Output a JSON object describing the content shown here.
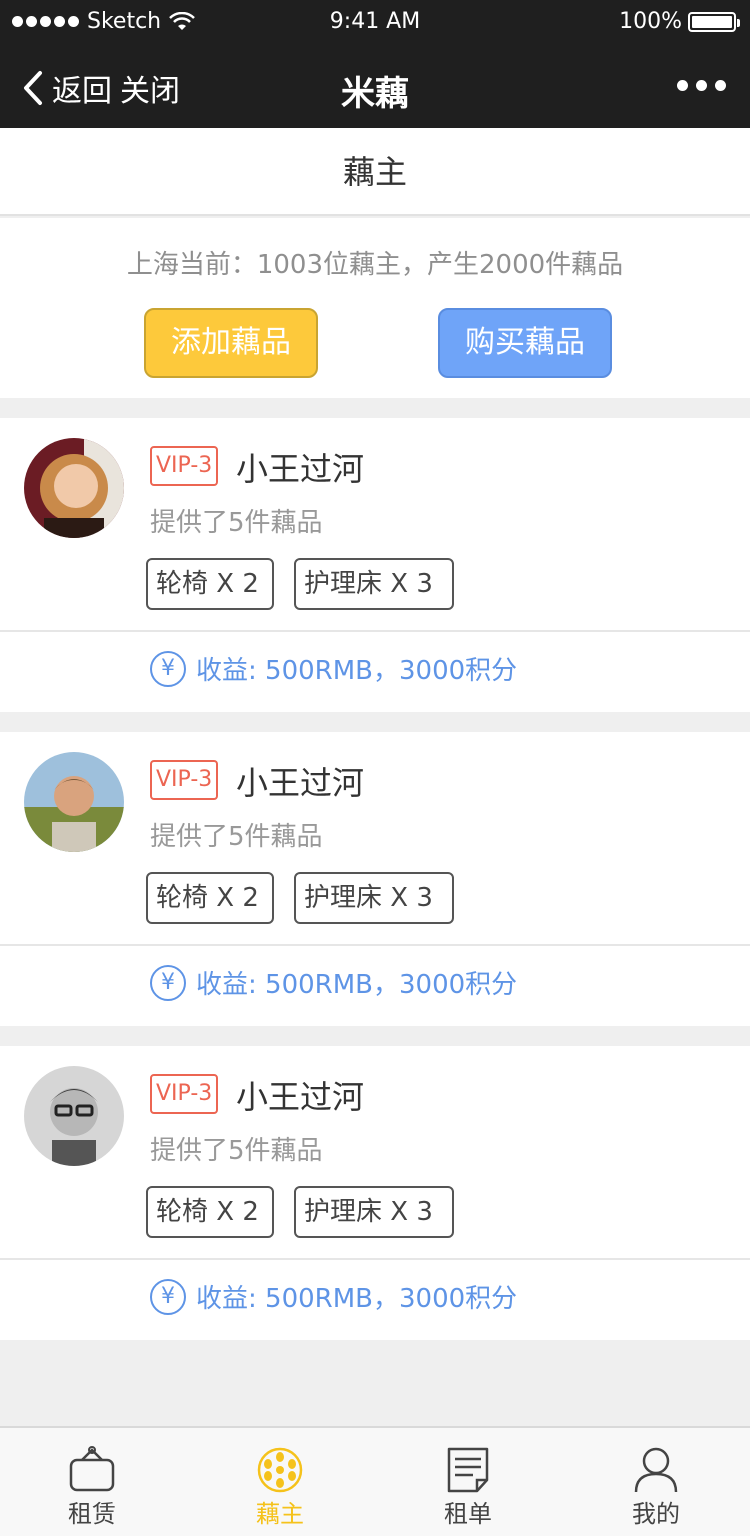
{
  "status_bar": {
    "carrier": "Sketch",
    "time": "9:41 AM",
    "battery": "100%"
  },
  "nav": {
    "back_label": "返回",
    "close_label": "关闭",
    "title": "米藕"
  },
  "tab_header": {
    "title": "藕主"
  },
  "summary": {
    "stat_text": "上海当前：1003位藕主，产生2000件藕品",
    "add_button": "添加藕品",
    "buy_button": "购买藕品"
  },
  "providers": [
    {
      "vip": "VIP-3",
      "name": "小王过河",
      "provided": "提供了5件藕品",
      "tags": [
        "轮椅 X 2",
        "护理床 X 3"
      ],
      "earnings": "收益: 500RMB，3000积分",
      "avatar": "woman-avatar"
    },
    {
      "vip": "VIP-3",
      "name": "小王过河",
      "provided": "提供了5件藕品",
      "tags": [
        "轮椅 X 2",
        "护理床 X 3"
      ],
      "earnings": "收益: 500RMB，3000积分",
      "avatar": "man-avatar"
    },
    {
      "vip": "VIP-3",
      "name": "小王过河",
      "provided": "提供了5件藕品",
      "tags": [
        "轮椅 X 2",
        "护理床 X 3"
      ],
      "earnings": "收益: 500RMB，3000积分",
      "avatar": "glasses-man-avatar"
    }
  ],
  "tabbar": {
    "items": [
      {
        "label": "租赁",
        "icon": "rental-bag-icon"
      },
      {
        "label": "藕主",
        "icon": "lotus-root-icon",
        "active": true
      },
      {
        "label": "租单",
        "icon": "order-list-icon"
      },
      {
        "label": "我的",
        "icon": "user-icon"
      }
    ]
  },
  "colors": {
    "accent_yellow": "#fdc93b",
    "accent_blue": "#6fa4f8",
    "vip_red": "#ec6552",
    "earn_blue": "#5e94e6"
  }
}
